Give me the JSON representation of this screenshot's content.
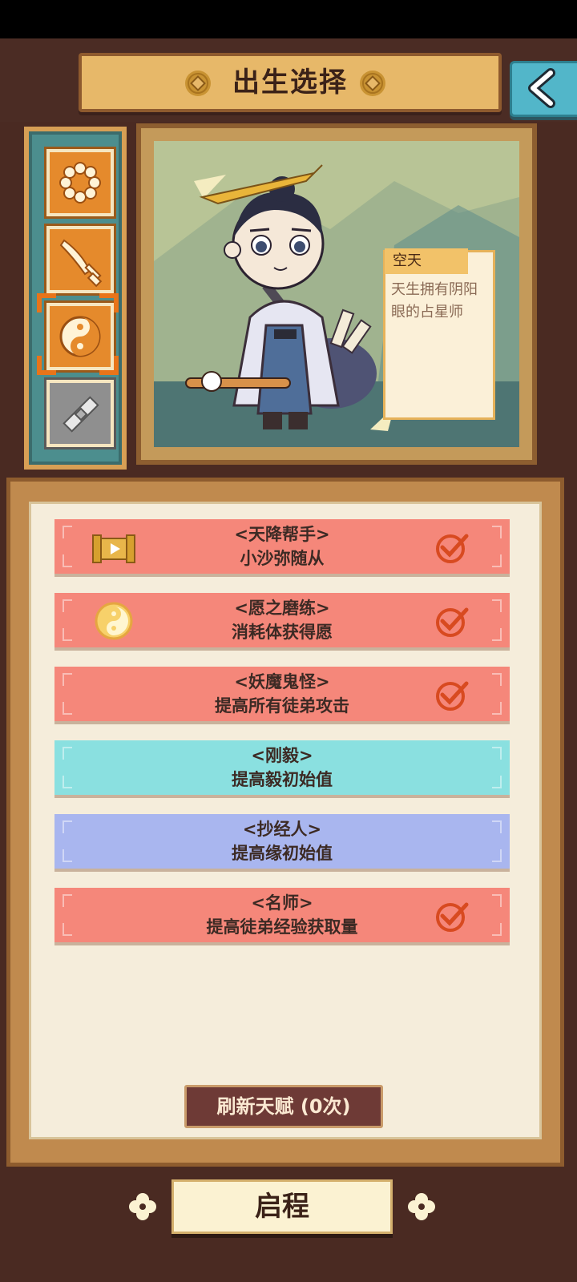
{
  "header": {
    "title": "出生选择"
  },
  "side_tabs": [
    {
      "icon": "beads-icon",
      "active": false
    },
    {
      "icon": "sword-icon",
      "active": false
    },
    {
      "icon": "yinyang-icon",
      "active": true
    },
    {
      "icon": "locked-scroll-icon",
      "active": false
    }
  ],
  "character": {
    "name": "空天",
    "description": "天生拥有阴阳眼的占星师"
  },
  "talents": [
    {
      "title": "<天降帮手>",
      "desc": "小沙弥随从",
      "color": "red",
      "icon": "video-scroll-icon",
      "checked": true
    },
    {
      "title": "<愿之磨练>",
      "desc": "消耗体获得愿",
      "color": "red",
      "icon": "yinyang-coin-icon",
      "checked": true
    },
    {
      "title": "<妖魔鬼怪>",
      "desc": "提高所有徒弟攻击",
      "color": "red",
      "icon": null,
      "checked": true
    },
    {
      "title": "<刚毅>",
      "desc": "提高毅初始值",
      "color": "cyan",
      "icon": null,
      "checked": false
    },
    {
      "title": "<抄经人>",
      "desc": "提高缘初始值",
      "color": "blue",
      "icon": null,
      "checked": false
    },
    {
      "title": "<名师>",
      "desc": "提高徒弟经验获取量",
      "color": "red",
      "icon": null,
      "checked": true
    }
  ],
  "refresh_label": "刷新天赋 (0次)",
  "start_label": "启程",
  "colors": {
    "talent_red": "#f5877a",
    "talent_cyan": "#8ae0e0",
    "talent_blue": "#a9b6ef",
    "accent_orange": "#e58a2c",
    "plaque_gold": "#e7b869"
  }
}
